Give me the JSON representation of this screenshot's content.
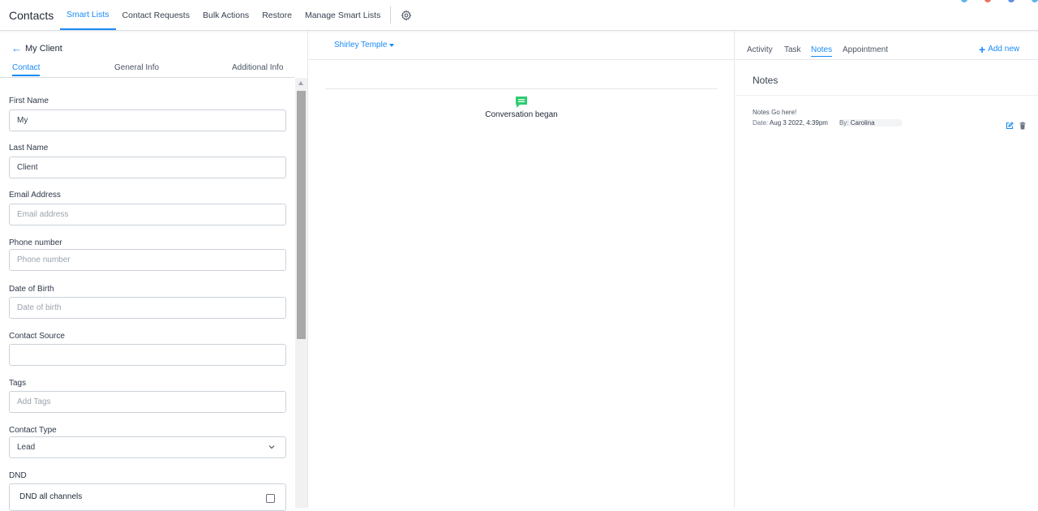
{
  "header": {
    "title": "Contacts",
    "nav": [
      {
        "label": "Smart Lists",
        "active": true
      },
      {
        "label": "Contact Requests",
        "active": false
      },
      {
        "label": "Bulk Actions",
        "active": false
      },
      {
        "label": "Restore",
        "active": false
      },
      {
        "label": "Manage Smart Lists",
        "active": false
      }
    ],
    "settings_icon": "gear-icon"
  },
  "left_panel": {
    "back_icon": "arrow-left-icon",
    "contact_name": "My Client",
    "tabs": [
      {
        "label": "Contact",
        "active": true
      },
      {
        "label": "General Info",
        "active": false
      },
      {
        "label": "Additional Info",
        "active": false
      }
    ],
    "fields": {
      "first_name": {
        "label": "First Name",
        "value": "My"
      },
      "last_name": {
        "label": "Last Name",
        "value": "Client"
      },
      "email": {
        "label": "Email Address",
        "placeholder": "Email address"
      },
      "phone": {
        "label": "Phone number",
        "placeholder": "Phone number"
      },
      "dob": {
        "label": "Date of Birth",
        "placeholder": "Date of birth"
      },
      "source": {
        "label": "Contact Source",
        "value": ""
      },
      "tags": {
        "label": "Tags",
        "placeholder": "Add Tags"
      },
      "type": {
        "label": "Contact Type",
        "value": "Lead"
      },
      "dnd": {
        "label": "DND",
        "option": "DND all channels",
        "checked": false
      }
    }
  },
  "middle_panel": {
    "selected_contact": "Shirley Temple",
    "conversation_status": "Conversation began",
    "conversation_icon": "chat-bubble-icon",
    "conversation_icon_color": "#2ecc71"
  },
  "right_panel": {
    "tabs": [
      {
        "label": "Activity",
        "active": false
      },
      {
        "label": "Task",
        "active": false
      },
      {
        "label": "Notes",
        "active": true
      },
      {
        "label": "Appointment",
        "active": false
      }
    ],
    "add_new": "Add new",
    "notes_title": "Notes",
    "note": {
      "text": "Notes Go here!",
      "date_label": "Date:",
      "date": "Aug 3 2022, 4:39pm",
      "by_label": "By:",
      "by": "Carolina"
    }
  },
  "colors": {
    "accent": "#188bf6",
    "success": "#2ecc71"
  }
}
